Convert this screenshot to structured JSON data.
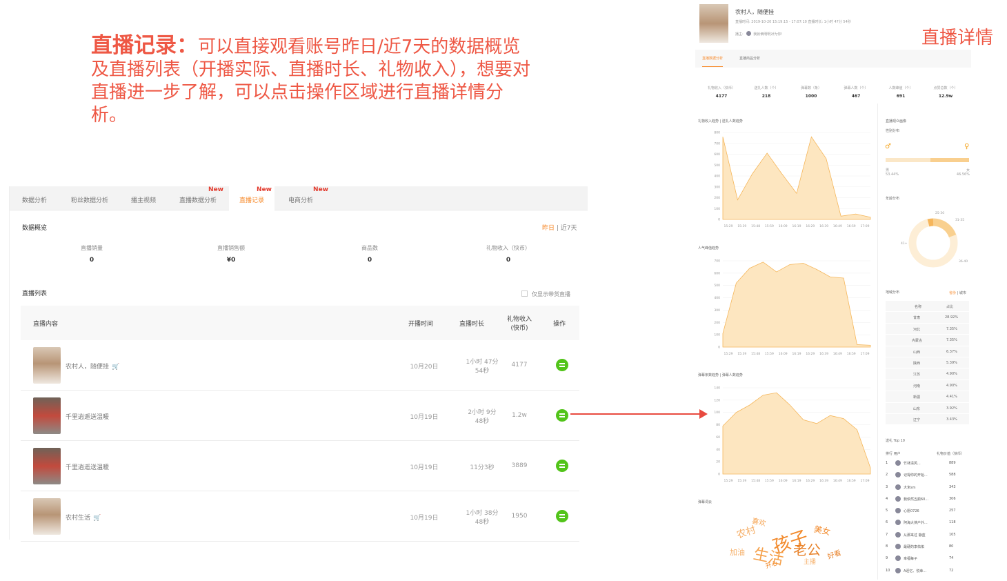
{
  "caption": {
    "lead": "直播记录：",
    "body": "可以直接观看账号昨日/近7天的数据概览及直播列表（开播实际、直播时长、礼物收入），想要对直播进一步了解，可以点击操作区域进行直播详情分析。"
  },
  "tabs": [
    {
      "label": "数据分析",
      "new": ""
    },
    {
      "label": "粉丝数据分析",
      "new": ""
    },
    {
      "label": "播主视频",
      "new": ""
    },
    {
      "label": "直播数据分析",
      "new": "New"
    },
    {
      "label": "直播记录",
      "new": "New"
    },
    {
      "label": "电商分析",
      "new": "New"
    }
  ],
  "overview": {
    "title": "数据概览",
    "period_yesterday": "昨日",
    "period_sep": " | ",
    "period_week": "近7天",
    "stats": [
      {
        "label": "直播销量",
        "value": "0"
      },
      {
        "label": "直播销售额",
        "value": "¥0"
      },
      {
        "label": "商品数",
        "value": "0"
      },
      {
        "label": "礼物收入（快币）",
        "value": "0"
      }
    ]
  },
  "list": {
    "title": "直播列表",
    "only_goods": "仅显示带货直播",
    "headers": {
      "content": "直播内容",
      "start": "开播时间",
      "duration": "直播时长",
      "gift_1": "礼物收入",
      "gift_2": "(快币)",
      "op": "操作"
    },
    "rows": [
      {
        "title": "农村人，随便挂",
        "cart": true,
        "date": "10月20日",
        "dur1": "1小时 47分",
        "dur2": "54秒",
        "gift": "4177"
      },
      {
        "title": "千里逍遥送温暖",
        "cart": false,
        "date": "10月19日",
        "dur1": "2小时 9分",
        "dur2": "48秒",
        "gift": "1.2w"
      },
      {
        "title": "千里逍遥送温暖",
        "cart": false,
        "date": "10月19日",
        "dur1": "11分3秒",
        "dur2": "",
        "gift": "3889"
      },
      {
        "title": "农村生活",
        "cart": true,
        "date": "10月19日",
        "dur1": "1小时 38分",
        "dur2": "48秒",
        "gift": "1950"
      }
    ],
    "cart_icon": "🛒"
  },
  "detail": {
    "heading": "直播详情",
    "name": "农村人，随便挂",
    "meta": "直播时间: 2019-10-20 15:19:15 - 17:07:10   直播时长: 1小时 47分 54秒",
    "host_label": "播主:",
    "host": "我就俩明明对为你!",
    "tabs": [
      "直播数据分析",
      "直播商品分析"
    ],
    "stats": [
      {
        "label": "礼物收入（快币）",
        "value": "4177"
      },
      {
        "label": "送礼人数（个）",
        "value": "218"
      },
      {
        "label": "弹幕数（条）",
        "value": "1000"
      },
      {
        "label": "弹幕人数（个）",
        "value": "467"
      },
      {
        "label": "人数峰值（个）",
        "value": "691"
      },
      {
        "label": "点赞总数（个）",
        "value": "12.9w"
      }
    ],
    "audience_title": "直播观众画像",
    "gender_title": "性别分布",
    "male_label": "男",
    "male_pct": "53.44%",
    "female_label": "女",
    "female_pct": "46.56%",
    "age_title": "年龄分布",
    "age_labels": [
      "25-30",
      "31-35",
      "41+",
      "36-40"
    ],
    "region_title": "地域分布",
    "region_toggle_on": "省份",
    "region_toggle_off": "城市",
    "region_head": {
      "name": "名称",
      "pct": "占比"
    },
    "regions": [
      {
        "name": "甘肃",
        "pct": "28.92%"
      },
      {
        "name": "河北",
        "pct": "7.35%"
      },
      {
        "name": "内蒙古",
        "pct": "7.35%"
      },
      {
        "name": "山西",
        "pct": "6.37%"
      },
      {
        "name": "陕西",
        "pct": "5.39%"
      },
      {
        "name": "江苏",
        "pct": "4.90%"
      },
      {
        "name": "河南",
        "pct": "4.90%"
      },
      {
        "name": "新疆",
        "pct": "4.41%"
      },
      {
        "name": "山东",
        "pct": "3.92%"
      },
      {
        "name": "辽宁",
        "pct": "3.43%"
      }
    ],
    "top10_title": "送礼 Top 10",
    "top10_head": {
      "rank": "排行",
      "user": "用户",
      "value": "礼物价值（快币）"
    },
    "top10": [
      {
        "rank": "1",
        "user": "竹林清风...",
        "value": "889"
      },
      {
        "rank": "2",
        "user": "记得你的开始...",
        "value": "588"
      },
      {
        "rank": "3",
        "user": "大米sm",
        "value": "343"
      },
      {
        "rank": "4",
        "user": "我依然五颜60...",
        "value": "306"
      },
      {
        "rank": "5",
        "user": "心愿0726",
        "value": "257"
      },
      {
        "rank": "6",
        "user": "阿海大侠户外...",
        "value": "118"
      },
      {
        "rank": "7",
        "user": "从那来过 静蓝",
        "value": "105"
      },
      {
        "rank": "8",
        "user": "最硬的李佑佑",
        "value": "80"
      },
      {
        "rank": "9",
        "user": "幸福每子",
        "value": "74"
      },
      {
        "rank": "10",
        "user": "A迟忆、悦幸...",
        "value": "72"
      }
    ],
    "danmu_title": "弹幕词云",
    "words": [
      "孩子",
      "生活",
      "老公",
      "农村",
      "美女",
      "加油",
      "好看",
      "喜欢",
      "主播",
      "开心"
    ]
  },
  "chart_data": [
    {
      "type": "area",
      "title": "礼物收入趋势 | 送礼人数趋势",
      "x": [
        "15:29",
        "15:39",
        "15:48",
        "15:59",
        "16:09",
        "16:19",
        "16:29",
        "16:39",
        "16:49",
        "16:59",
        "17:09"
      ],
      "y": [
        760,
        180,
        420,
        610,
        420,
        240,
        760,
        560,
        30,
        50,
        20
      ],
      "ylim": [
        0,
        800
      ],
      "yticks": [
        0,
        100,
        200,
        300,
        400,
        500,
        600,
        700,
        800
      ]
    },
    {
      "type": "area",
      "title": "人气峰值趋势",
      "x": [
        "15:29",
        "15:39",
        "15:48",
        "15:59",
        "16:09",
        "16:19",
        "16:29",
        "16:39",
        "16:49",
        "16:59",
        "17:09"
      ],
      "y": [
        110,
        520,
        640,
        690,
        610,
        670,
        680,
        630,
        570,
        560,
        20,
        15
      ],
      "ylim": [
        0,
        700
      ],
      "yticks": [
        0,
        100,
        200,
        300,
        400,
        500,
        600,
        700
      ]
    },
    {
      "type": "area",
      "title": "弹幕条数趋势 | 弹幕人数趋势",
      "x": [
        "15:29",
        "15:39",
        "15:48",
        "15:59",
        "16:09",
        "16:19",
        "16:29",
        "16:39",
        "16:49",
        "16:59",
        "17:09"
      ],
      "y": [
        78,
        100,
        112,
        128,
        132,
        112,
        88,
        82,
        95,
        90,
        72,
        10
      ],
      "ylim": [
        0,
        140
      ],
      "yticks": [
        0,
        20,
        40,
        60,
        80,
        100,
        120,
        140
      ]
    }
  ]
}
